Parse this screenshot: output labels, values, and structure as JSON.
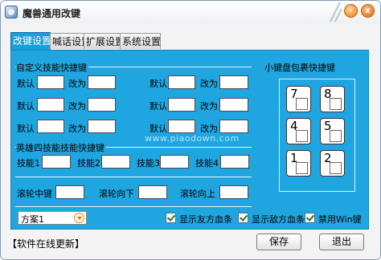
{
  "window": {
    "title": "魔兽通用改键",
    "minimize_symbol": "-",
    "close_symbol": "x",
    "accent": "#1fa6e0"
  },
  "tabs": [
    {
      "label": "改键设置",
      "active": true
    },
    {
      "label": "喊话设置",
      "active": false
    },
    {
      "label": "扩展设置",
      "active": false
    },
    {
      "label": "系统设置",
      "active": false
    }
  ],
  "custom_skill": {
    "title": "自定义技能快捷键",
    "default_label": "默认",
    "change_label": "改为",
    "rows": [
      {
        "left": {
          "default": "",
          "change": ""
        },
        "right": {
          "default": "",
          "change": ""
        }
      },
      {
        "left": {
          "default": "",
          "change": ""
        },
        "right": {
          "default": "",
          "change": ""
        }
      },
      {
        "left": {
          "default": "",
          "change": ""
        },
        "right": {
          "default": "",
          "change": ""
        }
      }
    ]
  },
  "numpad": {
    "title": "小键盘包裹快捷键",
    "keys": [
      {
        "num": "7",
        "value": ""
      },
      {
        "num": "8",
        "value": ""
      },
      {
        "num": "4",
        "value": ""
      },
      {
        "num": "5",
        "value": ""
      },
      {
        "num": "1",
        "value": ""
      },
      {
        "num": "2",
        "value": ""
      }
    ]
  },
  "watermark": "www.piaodown.com",
  "hero_skills": {
    "title": "英雄四技能技能快捷键",
    "labels": [
      "技能1",
      "技能2",
      "技能3",
      "技能4"
    ],
    "values": [
      "",
      "",
      "",
      ""
    ]
  },
  "wheel": {
    "middle_label": "滚轮中键",
    "middle_value": "",
    "down_label": "滚轮向下",
    "down_value": "",
    "up_label": "滚轮向上",
    "up_value": ""
  },
  "scheme": {
    "selected": "方案1"
  },
  "options": [
    {
      "label": "显示友方血条",
      "checked": true
    },
    {
      "label": "显示敌方血条",
      "checked": true
    },
    {
      "label": "禁用Win键",
      "checked": true
    }
  ],
  "footer": {
    "update_link": "【软件在线更新】",
    "save_label": "保存",
    "exit_label": "退出"
  }
}
